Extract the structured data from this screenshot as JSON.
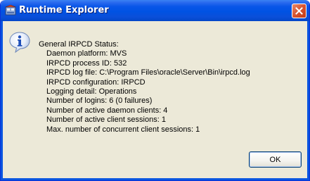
{
  "window": {
    "title": "Runtime Explorer"
  },
  "dialog": {
    "icon": "info-icon",
    "heading": "General IRPCD Status:",
    "lines": [
      "Daemon platform: MVS",
      "IRPCD process ID: 532",
      "IRPCD log file: C:\\Program Files\\oracle\\Server\\Bin\\irpcd.log",
      "IRPCD configuration: IRPCD",
      "Logging detail: Operations",
      "Number of logins: 6 (0 failures)",
      "Number of active daemon clients: 4",
      "Number of active client sessions: 1",
      "Max. number of concurrent client sessions: 1"
    ],
    "ok_label": "OK"
  }
}
